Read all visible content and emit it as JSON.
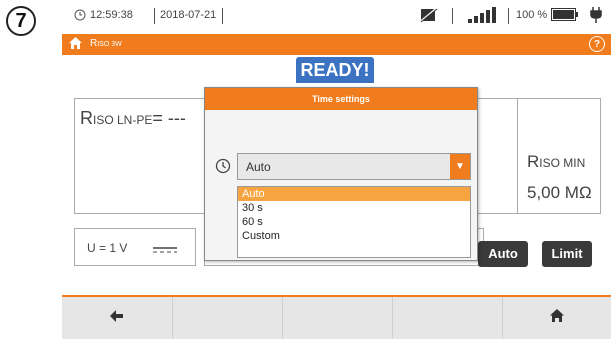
{
  "step_number": "7",
  "status": {
    "time": "12:59:38",
    "date": "2018-07-21",
    "battery_percent": "100 %"
  },
  "titlebar": {
    "title": "R",
    "title_sub": "ISO 3W"
  },
  "ready_label": "READY!",
  "main": {
    "riso_ln_pe_prefix": "R",
    "riso_ln_pe_sub": "ISO LN-PE",
    "riso_ln_pe_value": "= ---",
    "riso_min_prefix": "R",
    "riso_min_sub": "ISO MIN",
    "riso_min_value": "5,00 MΩ",
    "u_label": "U = 1 V"
  },
  "buttons": {
    "auto": "Auto",
    "limit": "Limit"
  },
  "dialog": {
    "title": "Time settings",
    "selected": "Auto",
    "options": [
      "Auto",
      "30 s",
      "60 s",
      "Custom"
    ]
  },
  "colors": {
    "accent": "#f07c1e",
    "ready": "#3b73c2"
  }
}
